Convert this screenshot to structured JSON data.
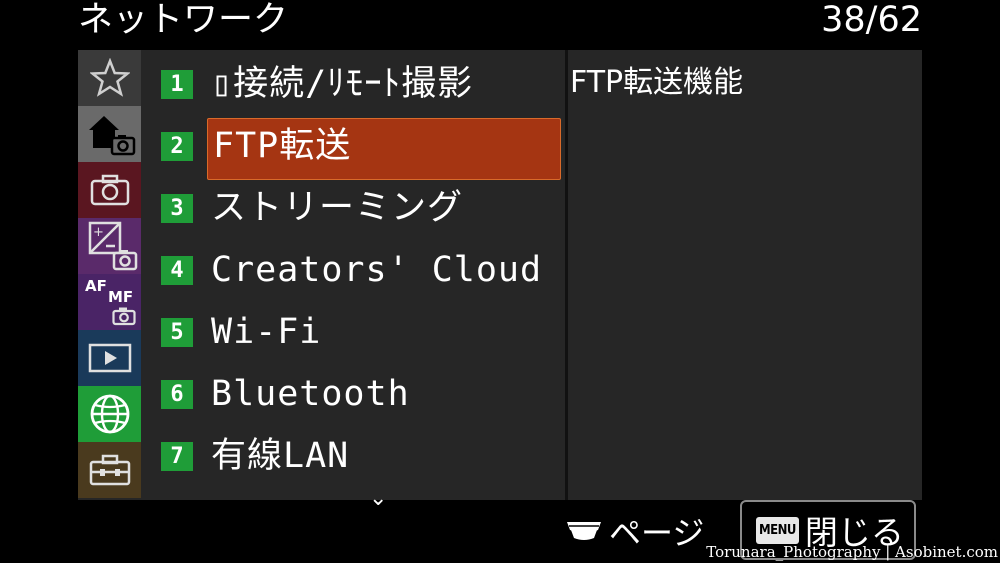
{
  "header": {
    "title": "ネットワーク",
    "page_counter": "38/62"
  },
  "sidebar": {
    "tabs": [
      {
        "name": "favorites",
        "icon": "star-icon",
        "bg": "#3a3a3a"
      },
      {
        "name": "main",
        "icon": "home-camera-icon",
        "bg": "#6a6a6a"
      },
      {
        "name": "shooting",
        "icon": "camera-icon",
        "bg": "#5a1620"
      },
      {
        "name": "exposure",
        "icon": "exposure-camera-icon",
        "bg": "#5a2a6a"
      },
      {
        "name": "focus",
        "icon": "af-mf-camera-icon",
        "bg": "#4a2466",
        "text_af": "AF",
        "text_mf": "MF"
      },
      {
        "name": "playback",
        "icon": "playback-icon",
        "bg": "#1a3a5a"
      },
      {
        "name": "network",
        "icon": "globe-icon",
        "bg": "#1f9d38"
      },
      {
        "name": "setup",
        "icon": "toolbox-icon",
        "bg": "#4a3a1e"
      }
    ]
  },
  "menu": {
    "items": [
      {
        "num": "1",
        "label": "▯接続/ﾘﾓｰﾄ撮影"
      },
      {
        "num": "2",
        "label": "FTP転送",
        "selected": true
      },
      {
        "num": "3",
        "label": "ストリーミング"
      },
      {
        "num": "4",
        "label": "Creators' Cloud"
      },
      {
        "num": "5",
        "label": "Wi-Fi"
      },
      {
        "num": "6",
        "label": "Bluetooth"
      },
      {
        "num": "7",
        "label": "有線LAN"
      }
    ],
    "scroll_indicator": "⌄"
  },
  "detail": {
    "text": "FTP転送機能"
  },
  "footer": {
    "page_label": "ページ",
    "close_key": "MENU",
    "close_label": "閉じる"
  },
  "watermark": "Torunara_Photography | Asobinet.com",
  "colors": {
    "accent_selected": "#a53512",
    "number_badge": "#1f9d38"
  }
}
